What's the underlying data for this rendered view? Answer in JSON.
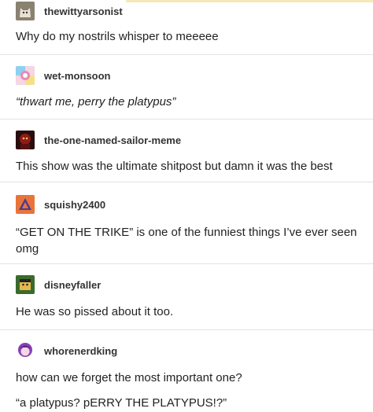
{
  "posts": [
    {
      "username": "thewittyarsonist",
      "text": "Why do my nostrils whisper to meeeee",
      "avatar_icon": "cat-avatar-icon"
    },
    {
      "username": "wet-monsoon",
      "text": "“thwart me, perry the platypus”",
      "avatar_icon": "colorful-art-avatar-icon"
    },
    {
      "username": "the-one-named-sailor-meme",
      "text": "This show was the ultimate shitpost but damn it was the best",
      "avatar_icon": "dark-red-avatar-icon"
    },
    {
      "username": "squishy2400",
      "text": "“GET ON THE TRIKE” is one of the funniest things I’ve ever seen omg",
      "avatar_icon": "triangle-logo-avatar-icon"
    },
    {
      "username": "disneyfaller",
      "text": "He was so pissed about it too.",
      "avatar_icon": "cartoon-character-avatar-icon"
    },
    {
      "username": "whorenerdking",
      "text": "how can we forget the most important one?",
      "text2": "“a platypus? pERRY THE PLATYPUS!?”",
      "avatar_icon": "purple-character-avatar-icon"
    }
  ]
}
